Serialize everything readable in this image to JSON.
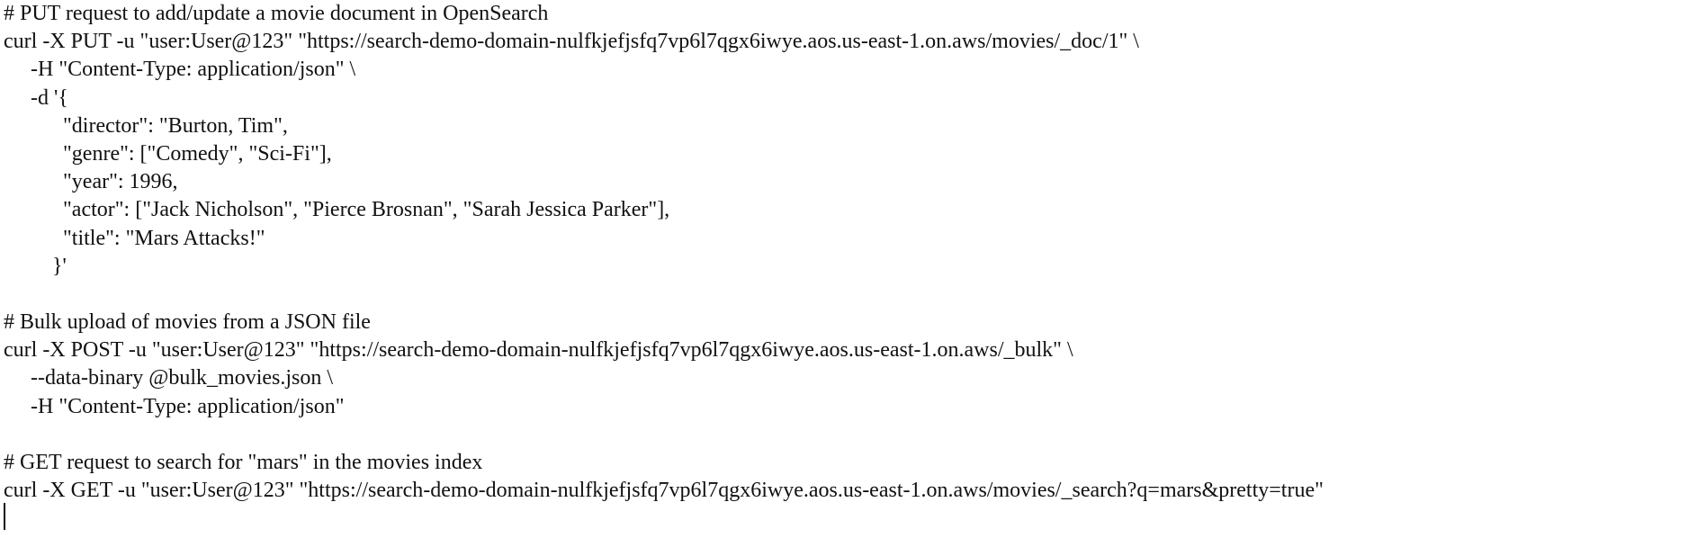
{
  "document": {
    "lines": [
      "# PUT request to add/update a movie document in OpenSearch",
      "curl -X PUT -u \"user:User@123\" \"https://search-demo-domain-nulfkjefjsfq7vp6l7qgx6iwye.aos.us-east-1.on.aws/movies/_doc/1\" \\",
      "-H \"Content-Type: application/json\" \\",
      "-d '{",
      "\"director\": \"Burton, Tim\",",
      "\"genre\": [\"Comedy\", \"Sci-Fi\"],",
      "\"year\": 1996,",
      "\"actor\": [\"Jack Nicholson\", \"Pierce Brosnan\", \"Sarah Jessica Parker\"],",
      "\"title\": \"Mars Attacks!\"",
      "}'",
      "",
      "# Bulk upload of movies from a JSON file",
      "curl -X POST -u \"user:User@123\" \"https://search-demo-domain-nulfkjefjsfq7vp6l7qgx6iwye.aos.us-east-1.on.aws/_bulk\" \\",
      "--data-binary @bulk_movies.json \\",
      "-H \"Content-Type: application/json\"",
      "",
      "# GET request to search for \"mars\" in the movies index",
      "curl -X GET -u \"user:User@123\" \"https://search-demo-domain-nulfkjefjsfq7vp6l7qgx6iwye.aos.us-east-1.on.aws/movies/_search?q=mars&pretty=true\""
    ]
  }
}
